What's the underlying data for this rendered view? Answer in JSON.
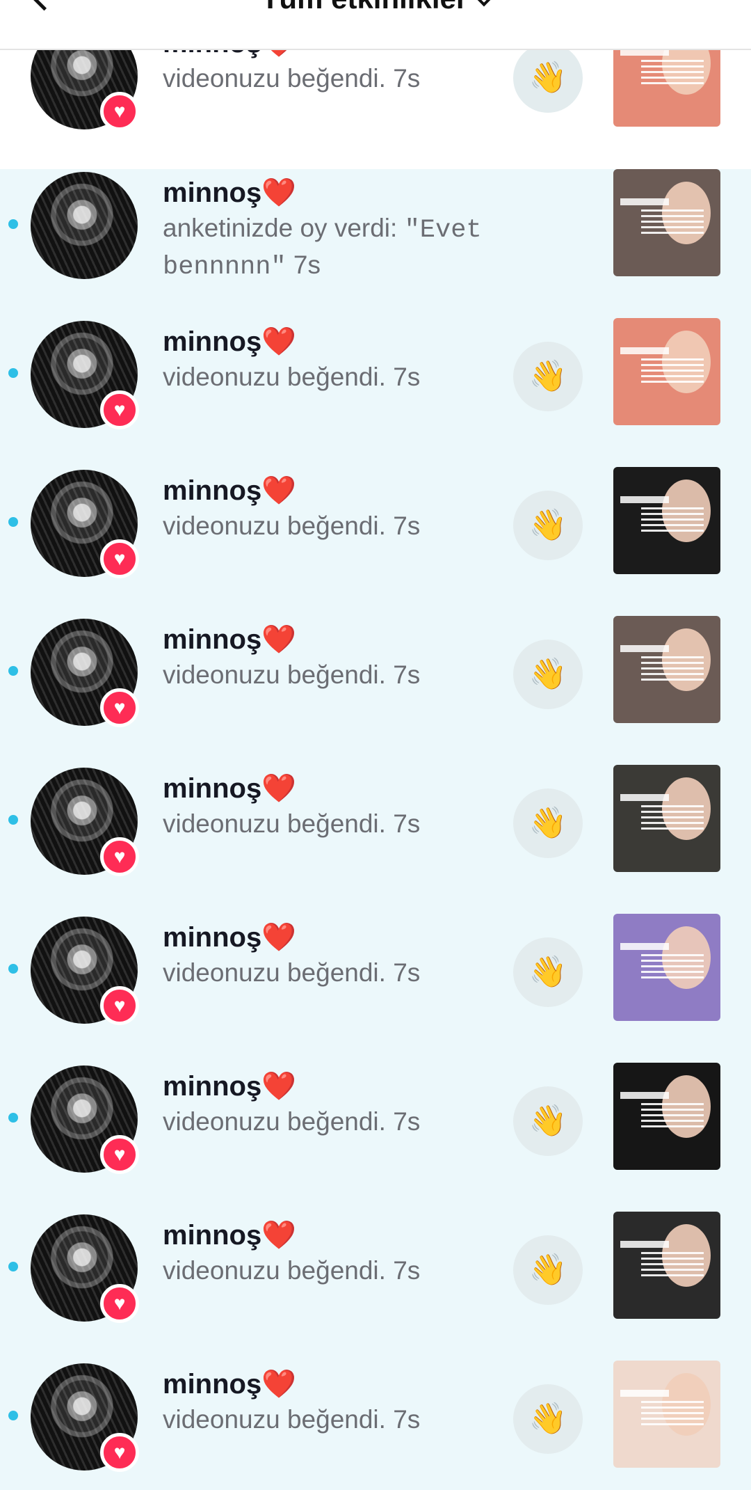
{
  "header": {
    "title": "Tüm etkinlikler"
  },
  "notifications": [
    {
      "name": "minnoş❤️",
      "text": "videonuzu beğendi.",
      "time": "7s",
      "unread": false,
      "thumb": "#e58a76"
    },
    {
      "name": "minnoş❤️",
      "text": "anketinizde oy verdi:",
      "quote": "\"Evet bennnnn\"",
      "time": "7s",
      "unread": true,
      "thumb": "#6b5b55"
    },
    {
      "name": "minnoş❤️",
      "text": "videonuzu beğendi.",
      "time": "7s",
      "unread": true,
      "thumb": "#e58a76"
    },
    {
      "name": "minnoş❤️",
      "text": "videonuzu beğendi.",
      "time": "7s",
      "unread": true,
      "thumb": "#1b1b1b"
    },
    {
      "name": "minnoş❤️",
      "text": "videonuzu beğendi.",
      "time": "7s",
      "unread": true,
      "thumb": "#6b5b55"
    },
    {
      "name": "minnoş❤️",
      "text": "videonuzu beğendi.",
      "time": "7s",
      "unread": true,
      "thumb": "#3b3a36"
    },
    {
      "name": "minnoş❤️",
      "text": "videonuzu beğendi.",
      "time": "7s",
      "unread": true,
      "thumb": "#8f7cc4"
    },
    {
      "name": "minnoş❤️",
      "text": "videonuzu beğendi.",
      "time": "7s",
      "unread": true,
      "thumb": "#161616"
    },
    {
      "name": "minnoş❤️",
      "text": "videonuzu beğendi.",
      "time": "7s",
      "unread": true,
      "thumb": "#2a2a2a"
    },
    {
      "name": "minnoş❤️",
      "text": "videonuzu beğendi.",
      "time": "7s",
      "unread": true,
      "thumb": "#efd9cd"
    }
  ]
}
